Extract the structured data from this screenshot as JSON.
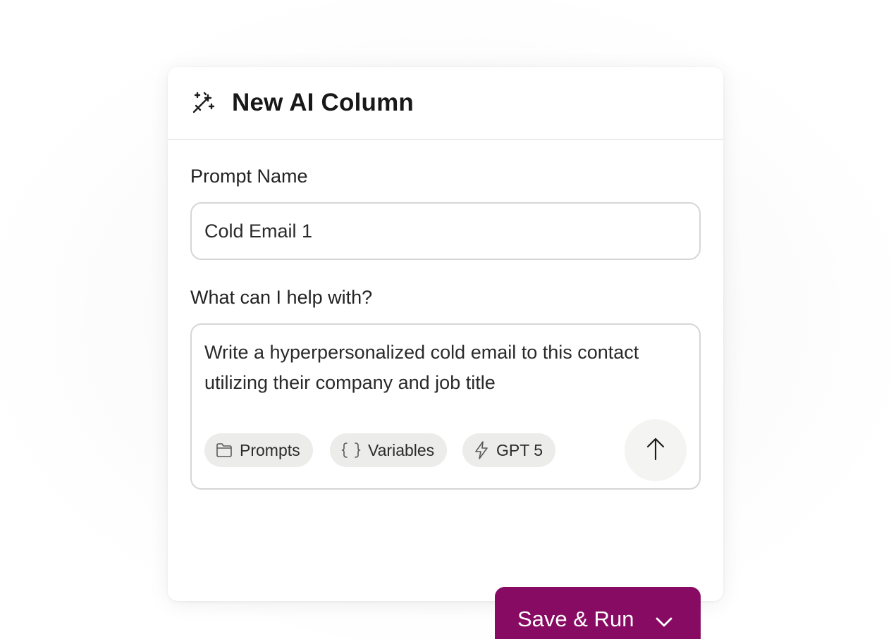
{
  "dialog": {
    "title": "New AI Column",
    "header_icon": "magic-wand-icon"
  },
  "prompt_name": {
    "label": "Prompt Name",
    "value": "Cold Email 1"
  },
  "prompt": {
    "label": "What can I help with?",
    "text": "Write a hyperpersonalized cold email to this contact utilizing their company and job title"
  },
  "chips": {
    "prompts": {
      "label": "Prompts",
      "icon": "folder-icon"
    },
    "variables": {
      "label": "Variables",
      "icon": "curly-braces-icon"
    },
    "model": {
      "label": "GPT 5",
      "icon": "lightning-icon"
    }
  },
  "send_button": {
    "icon": "arrow-up-icon"
  },
  "save_button": {
    "label": "Save & Run",
    "icon": "chevron-down-icon",
    "color": "#870b62"
  }
}
